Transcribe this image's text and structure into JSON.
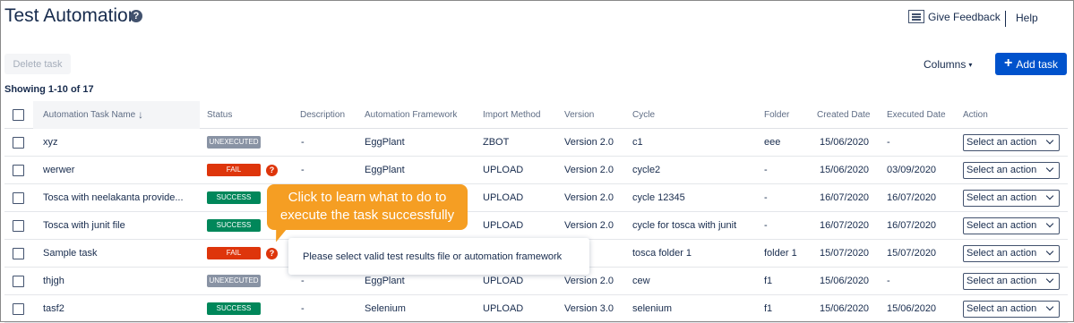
{
  "header": {
    "title": "Test Automation",
    "help_glyph": "?",
    "give_feedback": "Give Feedback",
    "help": "Help"
  },
  "toolbar": {
    "delete_task": "Delete task",
    "columns": "Columns",
    "columns_caret": "▾",
    "add_task": "Add task",
    "add_task_glyph": "+"
  },
  "showing": "Showing 1-10 of 17",
  "table": {
    "columns": [
      "Automation Task Name",
      "Status",
      "Description",
      "Automation Framework",
      "Import Method",
      "Version",
      "Cycle",
      "Folder",
      "Created Date",
      "Executed Date",
      "Action"
    ],
    "sort_glyph": "↓",
    "rows": [
      {
        "name": "xyz",
        "status": "UNEXECUTED",
        "status_kind": "unexecuted",
        "info": false,
        "description": "-",
        "framework": "EggPlant",
        "import_method": "ZBOT",
        "version": "Version 2.0",
        "cycle": "c1",
        "folder": "eee",
        "created": "15/06/2020",
        "executed": "-",
        "action": "Select an action"
      },
      {
        "name": "werwer",
        "status": "FAIL",
        "status_kind": "fail",
        "info": true,
        "description": "-",
        "framework": "EggPlant",
        "import_method": "UPLOAD",
        "version": "Version 2.0",
        "cycle": "cycle2",
        "folder": "-",
        "created": "15/06/2020",
        "executed": "03/09/2020",
        "action": "Select an action"
      },
      {
        "name": "Tosca with neelakanta provide...",
        "status": "SUCCESS",
        "status_kind": "success",
        "info": false,
        "description": "",
        "framework": "",
        "import_method": "UPLOAD",
        "version": "Version 2.0",
        "cycle": "cycle 12345",
        "folder": "-",
        "created": "16/07/2020",
        "executed": "16/07/2020",
        "action": "Select an action"
      },
      {
        "name": "Tosca with junit file",
        "status": "SUCCESS",
        "status_kind": "success",
        "info": false,
        "description": "",
        "framework": "",
        "import_method": "UPLOAD",
        "version": "Version 2.0",
        "cycle": "cycle for tosca with junit",
        "folder": "-",
        "created": "16/07/2020",
        "executed": "16/07/2020",
        "action": "Select an action"
      },
      {
        "name": "Sample task",
        "status": "FAIL",
        "status_kind": "fail",
        "info": true,
        "description": "",
        "framework": "",
        "import_method": "",
        "version": "n 2.0",
        "cycle": "tosca folder 1",
        "folder": "folder 1",
        "created": "15/07/2020",
        "executed": "15/07/2020",
        "action": "Select an action"
      },
      {
        "name": "thjgh",
        "status": "UNEXECUTED",
        "status_kind": "unexecuted",
        "info": false,
        "description": "-",
        "framework": "EggPlant",
        "import_method": "UPLOAD",
        "version": "Version 2.0",
        "cycle": "cew",
        "folder": "f1",
        "created": "15/06/2020",
        "executed": "-",
        "action": "Select an action"
      },
      {
        "name": "tasf2",
        "status": "SUCCESS",
        "status_kind": "success",
        "info": false,
        "description": "-",
        "framework": "Selenium",
        "import_method": "UPLOAD",
        "version": "Version 3.0",
        "cycle": "selenium",
        "folder": "f1",
        "created": "15/06/2020",
        "executed": "15/06/2020",
        "action": "Select an action"
      }
    ]
  },
  "callout": {
    "line1": "Click to learn what to do to",
    "line2": "execute the task successfully"
  },
  "tooltip": "Please select valid test results file or automation framework",
  "colors": {
    "primary": "#0052cc",
    "fail": "#de350b",
    "success": "#00875a",
    "unexecuted": "#8993a4",
    "callout": "#f59e23"
  }
}
